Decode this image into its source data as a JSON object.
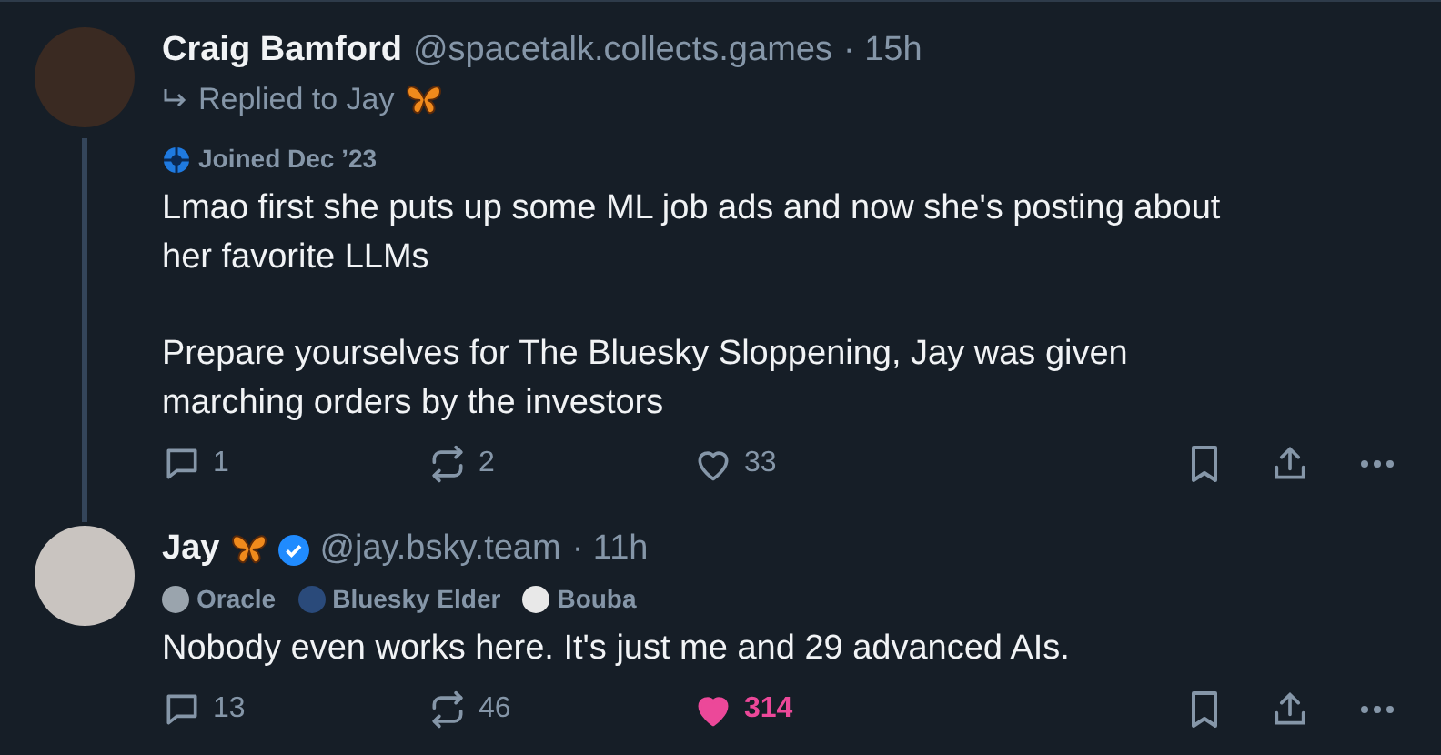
{
  "posts": [
    {
      "author": "Craig Bamford",
      "verified": false,
      "name_emoji": false,
      "handle": "@spacetalk.collects.games",
      "time": "· 15h",
      "reply_to": "Replied to Jay",
      "thread_line": true,
      "badges": [
        {
          "kind": "joined",
          "label": "Joined Dec ’23"
        }
      ],
      "paragraphs": [
        "Lmao first she puts up some ML job ads and now she's posting about her favorite LLMs",
        "Prepare yourselves for The Bluesky Sloppening, Jay was given marching orders by the investors"
      ],
      "replies": "1",
      "reposts": "2",
      "likes": "33",
      "liked": false
    },
    {
      "author": "Jay",
      "verified": true,
      "name_emoji": true,
      "handle": "@jay.bsky.team",
      "time": "· 11h",
      "thread_line": false,
      "badges": [
        {
          "kind": "avatar",
          "label": "Oracle"
        },
        {
          "kind": "avatar",
          "label": "Bluesky Elder"
        },
        {
          "kind": "avatar",
          "label": "Bouba"
        }
      ],
      "paragraphs": [
        "Nobody even works here. It's just me and 29 advanced AIs."
      ],
      "replies": "13",
      "reposts": "46",
      "likes": "314",
      "liked": true
    }
  ]
}
